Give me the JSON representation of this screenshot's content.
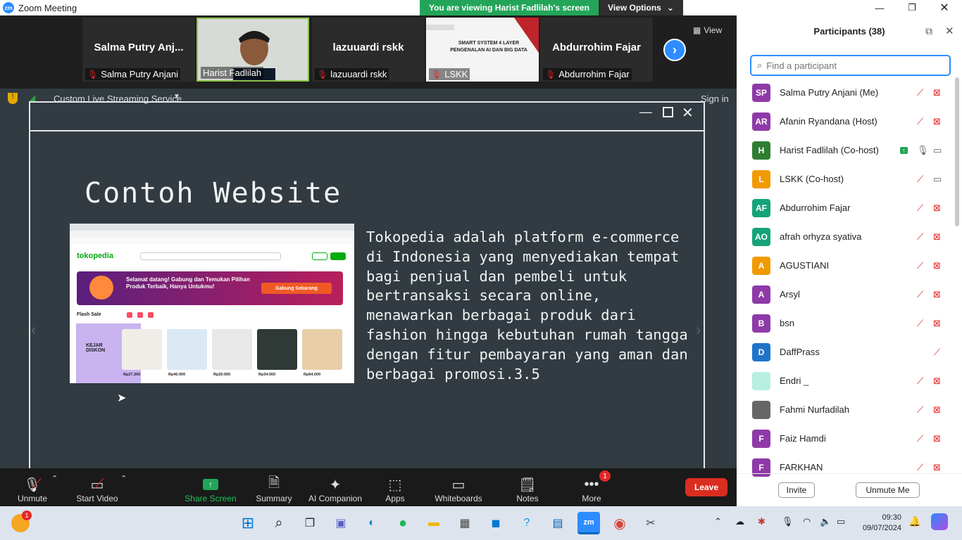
{
  "titlebar": {
    "app_title": "Zoom Meeting",
    "logo_text": "zm"
  },
  "banner": {
    "message": "You are viewing Harist Fadlilah's screen",
    "view_options": "View Options"
  },
  "strip": {
    "tiles": [
      {
        "big": "Salma Putry Anj...",
        "label": "Salma Putry Anjani"
      },
      {
        "big": "",
        "label": "Harist Fadlilah"
      },
      {
        "big": "lazuuardi rskk",
        "label": "lazuuardi rskk"
      },
      {
        "big": "",
        "label": "LSKK"
      },
      {
        "big": "Abdurrohim Fajar",
        "label": "Abdurrohim Fajar"
      }
    ],
    "view_label": "View",
    "lskk_slide_text": "SMART SYSTEM 4 LAYER PENGENALAN AI DAN BIG DATA"
  },
  "share": {
    "service": "Custom Live Streaming Service",
    "signin": "Sign in",
    "slide_title": "Contoh Website",
    "slide_body": "Tokopedia adalah platform e-commerce di Indonesia yang menyediakan tempat bagi penjual dan pembeli untuk bertransaksi secara online, menawarkan berbagai produk dari fashion hingga kebutuhan rumah tangga dengan fitur pembayaran yang aman dan berbagai promosi.3.5",
    "website": {
      "logo": "tokopedia",
      "promo_text": "Selamat datang! Gabung dan Temukan Pilihan Produk Terbaik, Hanya Untukmu!",
      "promo_button": "Gabung Sekarang",
      "flash": "Flash Sale",
      "promo_left": "KEJAR DISKON",
      "prices": [
        "Rp27.300",
        "Rp40.000",
        "Rp20.000",
        "Rp34.000",
        "Rp64.000"
      ]
    }
  },
  "participants": {
    "header": "Participants (38)",
    "search_placeholder": "Find a participant",
    "list": [
      {
        "initials": "SP",
        "name": "Salma Putry Anjani (Me)",
        "color": "#8e3aa8",
        "mic": "muted",
        "video": "off"
      },
      {
        "initials": "AR",
        "name": "Afanin Ryandana (Host)",
        "color": "#8e3aa8",
        "mic": "muted",
        "video": "off"
      },
      {
        "initials": "H",
        "name": "Harist Fadlilah (Co-host)",
        "color": "#2e7d32",
        "mic": "on",
        "video": "on",
        "sharing": true
      },
      {
        "initials": "L",
        "name": "LSKK (Co-host)",
        "color": "#f09a00",
        "mic": "muted",
        "video": "on"
      },
      {
        "initials": "AF",
        "name": "Abdurrohim Fajar",
        "color": "#15a37a",
        "mic": "muted",
        "video": "off"
      },
      {
        "initials": "AO",
        "name": "afrah orhyza syativa",
        "color": "#15a37a",
        "mic": "muted",
        "video": "off"
      },
      {
        "initials": "A",
        "name": "AGUSTIANI",
        "color": "#f09a00",
        "mic": "muted",
        "video": "off"
      },
      {
        "initials": "A",
        "name": "Arsyl",
        "color": "#8e3aa8",
        "mic": "muted",
        "video": "off"
      },
      {
        "initials": "B",
        "name": "bsn",
        "color": "#8e3aa8",
        "mic": "muted",
        "video": "off"
      },
      {
        "initials": "D",
        "name": "DaffPrass",
        "color": "#1e74c8",
        "mic": "muted",
        "video": "none"
      },
      {
        "initials": "",
        "name": "Endri _",
        "color": "#b7efe0",
        "mic": "muted",
        "video": "off"
      },
      {
        "initials": "",
        "name": "Fahmi Nurfadilah",
        "color": "#666666",
        "mic": "muted",
        "video": "off"
      },
      {
        "initials": "F",
        "name": "Faiz Hamdi",
        "color": "#8e3aa8",
        "mic": "muted",
        "video": "off"
      },
      {
        "initials": "F",
        "name": "FARKHAN",
        "color": "#8e3aa8",
        "mic": "muted",
        "video": "off"
      }
    ],
    "invite": "Invite",
    "unmute_me": "Unmute Me"
  },
  "toolbar": {
    "unmute": "Unmute",
    "start_video": "Start Video",
    "share_screen": "Share Screen",
    "summary": "Summary",
    "ai_companion": "AI Companion",
    "apps": "Apps",
    "whiteboards": "Whiteboards",
    "notes": "Notes",
    "more": "More",
    "more_badge": "1",
    "leave": "Leave"
  },
  "taskbar": {
    "time": "09:30",
    "date": "09/07/2024",
    "weather_badge": "1"
  },
  "colors": {
    "zoom_blue": "#2d8cff",
    "banner_green": "#23a559",
    "leave_red": "#d92d20",
    "slide_bg": "#313b41"
  }
}
